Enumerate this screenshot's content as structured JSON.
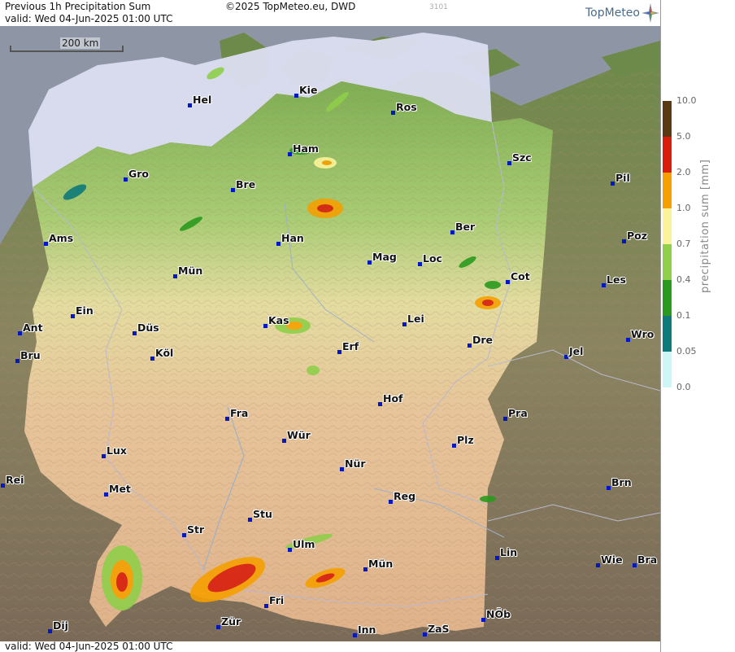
{
  "header": {
    "title": "Previous 1h Precipitation Sum",
    "copyright": "©2025 TopMeteo.eu, DWD",
    "code": "3101",
    "valid": "valid:  Wed  04-Jun-2025 01:00 UTC"
  },
  "brand": {
    "name": "TopMeteo",
    "color": "#4a6b8a"
  },
  "footer": {
    "valid": "valid:  Wed  04-Jun-2025 01:00 UTC"
  },
  "scale_bar": {
    "label": "200 km"
  },
  "legend": {
    "title": "precipitation sum [mm]",
    "levels": [
      "10.0",
      "5.0",
      "2.0",
      "1.0",
      "0.7",
      "0.4",
      "0.1",
      "0.05",
      "0.0"
    ],
    "colors": [
      "#5a3a12",
      "#d91c0c",
      "#f5a000",
      "#fbf39a",
      "#8fcf4a",
      "#2a9a1e",
      "#0e7a7a",
      "#cdf6f6"
    ]
  },
  "cities": [
    {
      "name": "Hel"
    },
    {
      "name": "Kie"
    },
    {
      "name": "Ros"
    },
    {
      "name": "Ham"
    },
    {
      "name": "Szc"
    },
    {
      "name": "Gro"
    },
    {
      "name": "Bre"
    },
    {
      "name": "Pil"
    },
    {
      "name": "Ber"
    },
    {
      "name": "Ams"
    },
    {
      "name": "Han"
    },
    {
      "name": "Poz"
    },
    {
      "name": "Mag"
    },
    {
      "name": "Loc"
    },
    {
      "name": "Mün"
    },
    {
      "name": "Cot"
    },
    {
      "name": "Les"
    },
    {
      "name": "Ein"
    },
    {
      "name": "Kas"
    },
    {
      "name": "Lei"
    },
    {
      "name": "Ant"
    },
    {
      "name": "Düs"
    },
    {
      "name": "Wro"
    },
    {
      "name": "Bru"
    },
    {
      "name": "Köl"
    },
    {
      "name": "Erf"
    },
    {
      "name": "Dre"
    },
    {
      "name": "Jel"
    },
    {
      "name": "Hof"
    },
    {
      "name": "Fra"
    },
    {
      "name": "Pra"
    },
    {
      "name": "Wür"
    },
    {
      "name": "Plz"
    },
    {
      "name": "Lux"
    },
    {
      "name": "Nür"
    },
    {
      "name": "Rei"
    },
    {
      "name": "Met"
    },
    {
      "name": "Brn"
    },
    {
      "name": "Reg"
    },
    {
      "name": "Stu"
    },
    {
      "name": "Str"
    },
    {
      "name": "Ulm"
    },
    {
      "name": "Lin"
    },
    {
      "name": "Mün"
    },
    {
      "name": "Wie"
    },
    {
      "name": "Bra"
    },
    {
      "name": "Fri"
    },
    {
      "name": "NÖb"
    },
    {
      "name": "Zür"
    },
    {
      "name": "Dij"
    },
    {
      "name": "Inn"
    },
    {
      "name": "ZaS"
    }
  ]
}
